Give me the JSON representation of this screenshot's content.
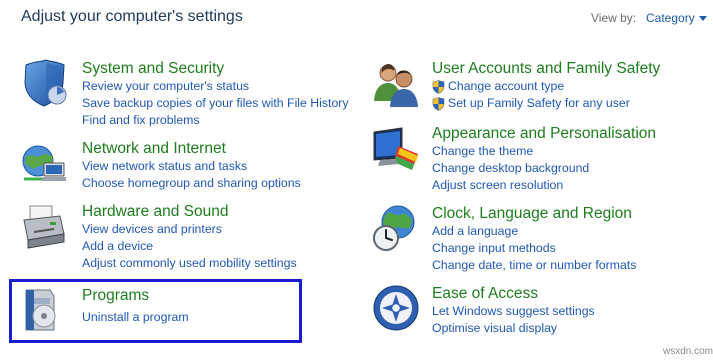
{
  "header": {
    "title": "Adjust your computer's settings",
    "view_by_label": "View by:",
    "view_by_value": "Category"
  },
  "categories": [
    {
      "title": "System and Security",
      "icon": "shield-icon",
      "links": [
        {
          "label": "Review your computer's status",
          "shield": false
        },
        {
          "label": "Save backup copies of your files with File History",
          "shield": false
        },
        {
          "label": "Find and fix problems",
          "shield": false
        }
      ]
    },
    {
      "title": "Network and Internet",
      "icon": "network-icon",
      "links": [
        {
          "label": "View network status and tasks",
          "shield": false
        },
        {
          "label": "Choose homegroup and sharing options",
          "shield": false
        }
      ]
    },
    {
      "title": "Hardware and Sound",
      "icon": "printer-icon",
      "links": [
        {
          "label": "View devices and printers",
          "shield": false
        },
        {
          "label": "Add a device",
          "shield": false
        },
        {
          "label": "Adjust commonly used mobility settings",
          "shield": false
        }
      ]
    },
    {
      "title": "Programs",
      "icon": "programs-icon",
      "links": [
        {
          "label": "Uninstall a program",
          "shield": false
        }
      ]
    },
    {
      "title": "User Accounts and Family Safety",
      "icon": "users-icon",
      "links": [
        {
          "label": "Change account type",
          "shield": true
        },
        {
          "label": "Set up Family Safety for any user",
          "shield": true
        }
      ]
    },
    {
      "title": "Appearance and Personalisation",
      "icon": "display-icon",
      "links": [
        {
          "label": "Change the theme",
          "shield": false
        },
        {
          "label": "Change desktop background",
          "shield": false
        },
        {
          "label": "Adjust screen resolution",
          "shield": false
        }
      ]
    },
    {
      "title": "Clock, Language and Region",
      "icon": "clock-globe-icon",
      "links": [
        {
          "label": "Add a language",
          "shield": false
        },
        {
          "label": "Change input methods",
          "shield": false
        },
        {
          "label": "Change date, time or number formats",
          "shield": false
        }
      ]
    },
    {
      "title": "Ease of Access",
      "icon": "ease-of-access-icon",
      "links": [
        {
          "label": "Let Windows suggest settings",
          "shield": false
        },
        {
          "label": "Optimise visual display",
          "shield": false
        }
      ]
    }
  ],
  "highlighted_category": "Programs",
  "colors": {
    "title_green": "#1e7c1e",
    "link_blue": "#1f58b5",
    "highlight_border": "#1c1bd4"
  },
  "watermark": "wsxdn.com"
}
